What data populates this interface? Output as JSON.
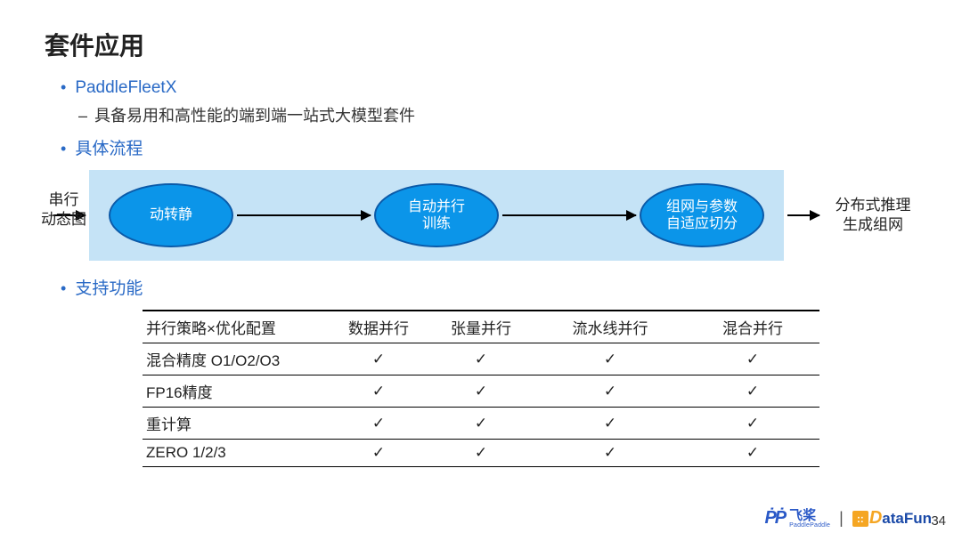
{
  "title": "套件应用",
  "b1": {
    "label": "PaddleFleetX",
    "sub": "具备易用和高性能的端到端一站式大模型套件"
  },
  "b2": {
    "label": "具体流程"
  },
  "flow": {
    "left1": "串行",
    "left2": "动态图",
    "n1": "动转静",
    "n2a": "自动并行",
    "n2b": "训练",
    "n3a": "组网与参数",
    "n3b": "自适应切分",
    "right1": "分布式推理",
    "right2": "生成组网"
  },
  "b3": {
    "label": "支持功能"
  },
  "table": {
    "h0": "并行策略×优化配置",
    "h1": "数据并行",
    "h2": "张量并行",
    "h3": "流水线并行",
    "h4": "混合并行",
    "r1": "混合精度 O1/O2/O3",
    "r2": "FP16精度",
    "r3": "重计算",
    "r4": "ZERO 1/2/3",
    "check": "✓"
  },
  "footer": {
    "pp_glyph": "ṖṖ",
    "pp_cn": "飞桨",
    "pp_en": "PaddlePaddle",
    "sep": "|",
    "df_sq": "::",
    "df_D": "D",
    "df_rest": "ataFun",
    "page": "34"
  }
}
